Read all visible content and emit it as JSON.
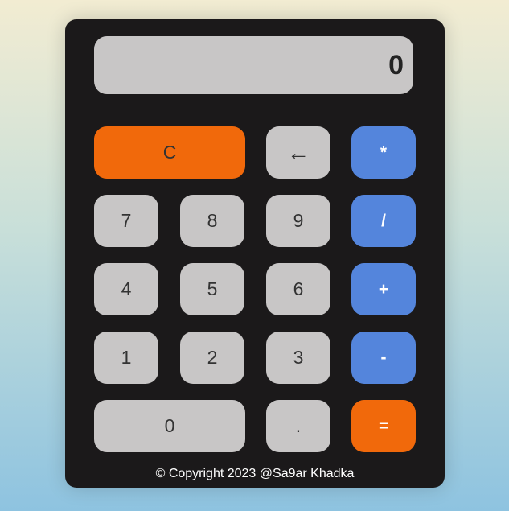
{
  "display": {
    "value": "0"
  },
  "keys": {
    "clear": "C",
    "backspace": "←",
    "multiply": "*",
    "divide": "/",
    "add": "+",
    "subtract": "-",
    "equals": "=",
    "decimal": ".",
    "d0": "0",
    "d1": "1",
    "d2": "2",
    "d3": "3",
    "d4": "4",
    "d5": "5",
    "d6": "6",
    "d7": "7",
    "d8": "8",
    "d9": "9"
  },
  "footer": {
    "copyright": "© Copyright 2023 @Sa9ar Khadka"
  },
  "colors": {
    "body_panel": "#1b191a",
    "key_gray": "#c8c6c6",
    "key_blue": "#5485dc",
    "key_orange": "#f1690b"
  }
}
